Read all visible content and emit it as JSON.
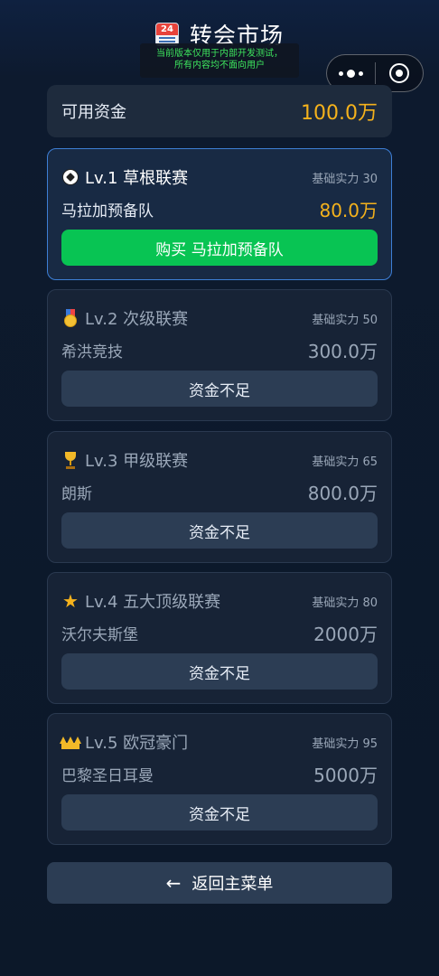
{
  "header": {
    "title": "转会市场",
    "debug_tip_line1": "当前版本仅用于内部开发测试，",
    "debug_tip_line2": "所有内容均不面向用户",
    "calendar_icon_text": "24"
  },
  "funds": {
    "label": "可用资金",
    "value": "100.0万"
  },
  "tiers": [
    {
      "level": "Lv.1 草根联赛",
      "icon": "soccer-ball-icon",
      "base_label": "基础实力 30",
      "team": "马拉加预备队",
      "price": "80.0万",
      "button": "购买 马拉加预备队",
      "affordable": true
    },
    {
      "level": "Lv.2 次级联赛",
      "icon": "medal-icon",
      "base_label": "基础实力 50",
      "team": "希洪竞技",
      "price": "300.0万",
      "button": "资金不足",
      "affordable": false
    },
    {
      "level": "Lv.3 甲级联赛",
      "icon": "trophy-icon",
      "base_label": "基础实力 65",
      "team": "朗斯",
      "price": "800.0万",
      "button": "资金不足",
      "affordable": false
    },
    {
      "level": "Lv.4 五大顶级联赛",
      "icon": "star-icon",
      "base_label": "基础实力 80",
      "team": "沃尔夫斯堡",
      "price": "2000万",
      "button": "资金不足",
      "affordable": false
    },
    {
      "level": "Lv.5 欧冠豪门",
      "icon": "crown-icon",
      "base_label": "基础实力 95",
      "team": "巴黎圣日耳曼",
      "price": "5000万",
      "button": "资金不足",
      "affordable": false
    }
  ],
  "back_button": {
    "arrow": "←",
    "label": "返回主菜单"
  },
  "colors": {
    "accent_gold": "#f5b21c",
    "buy_green": "#08c453",
    "active_border": "#3d7fd6",
    "background": "#0d1a2e"
  }
}
